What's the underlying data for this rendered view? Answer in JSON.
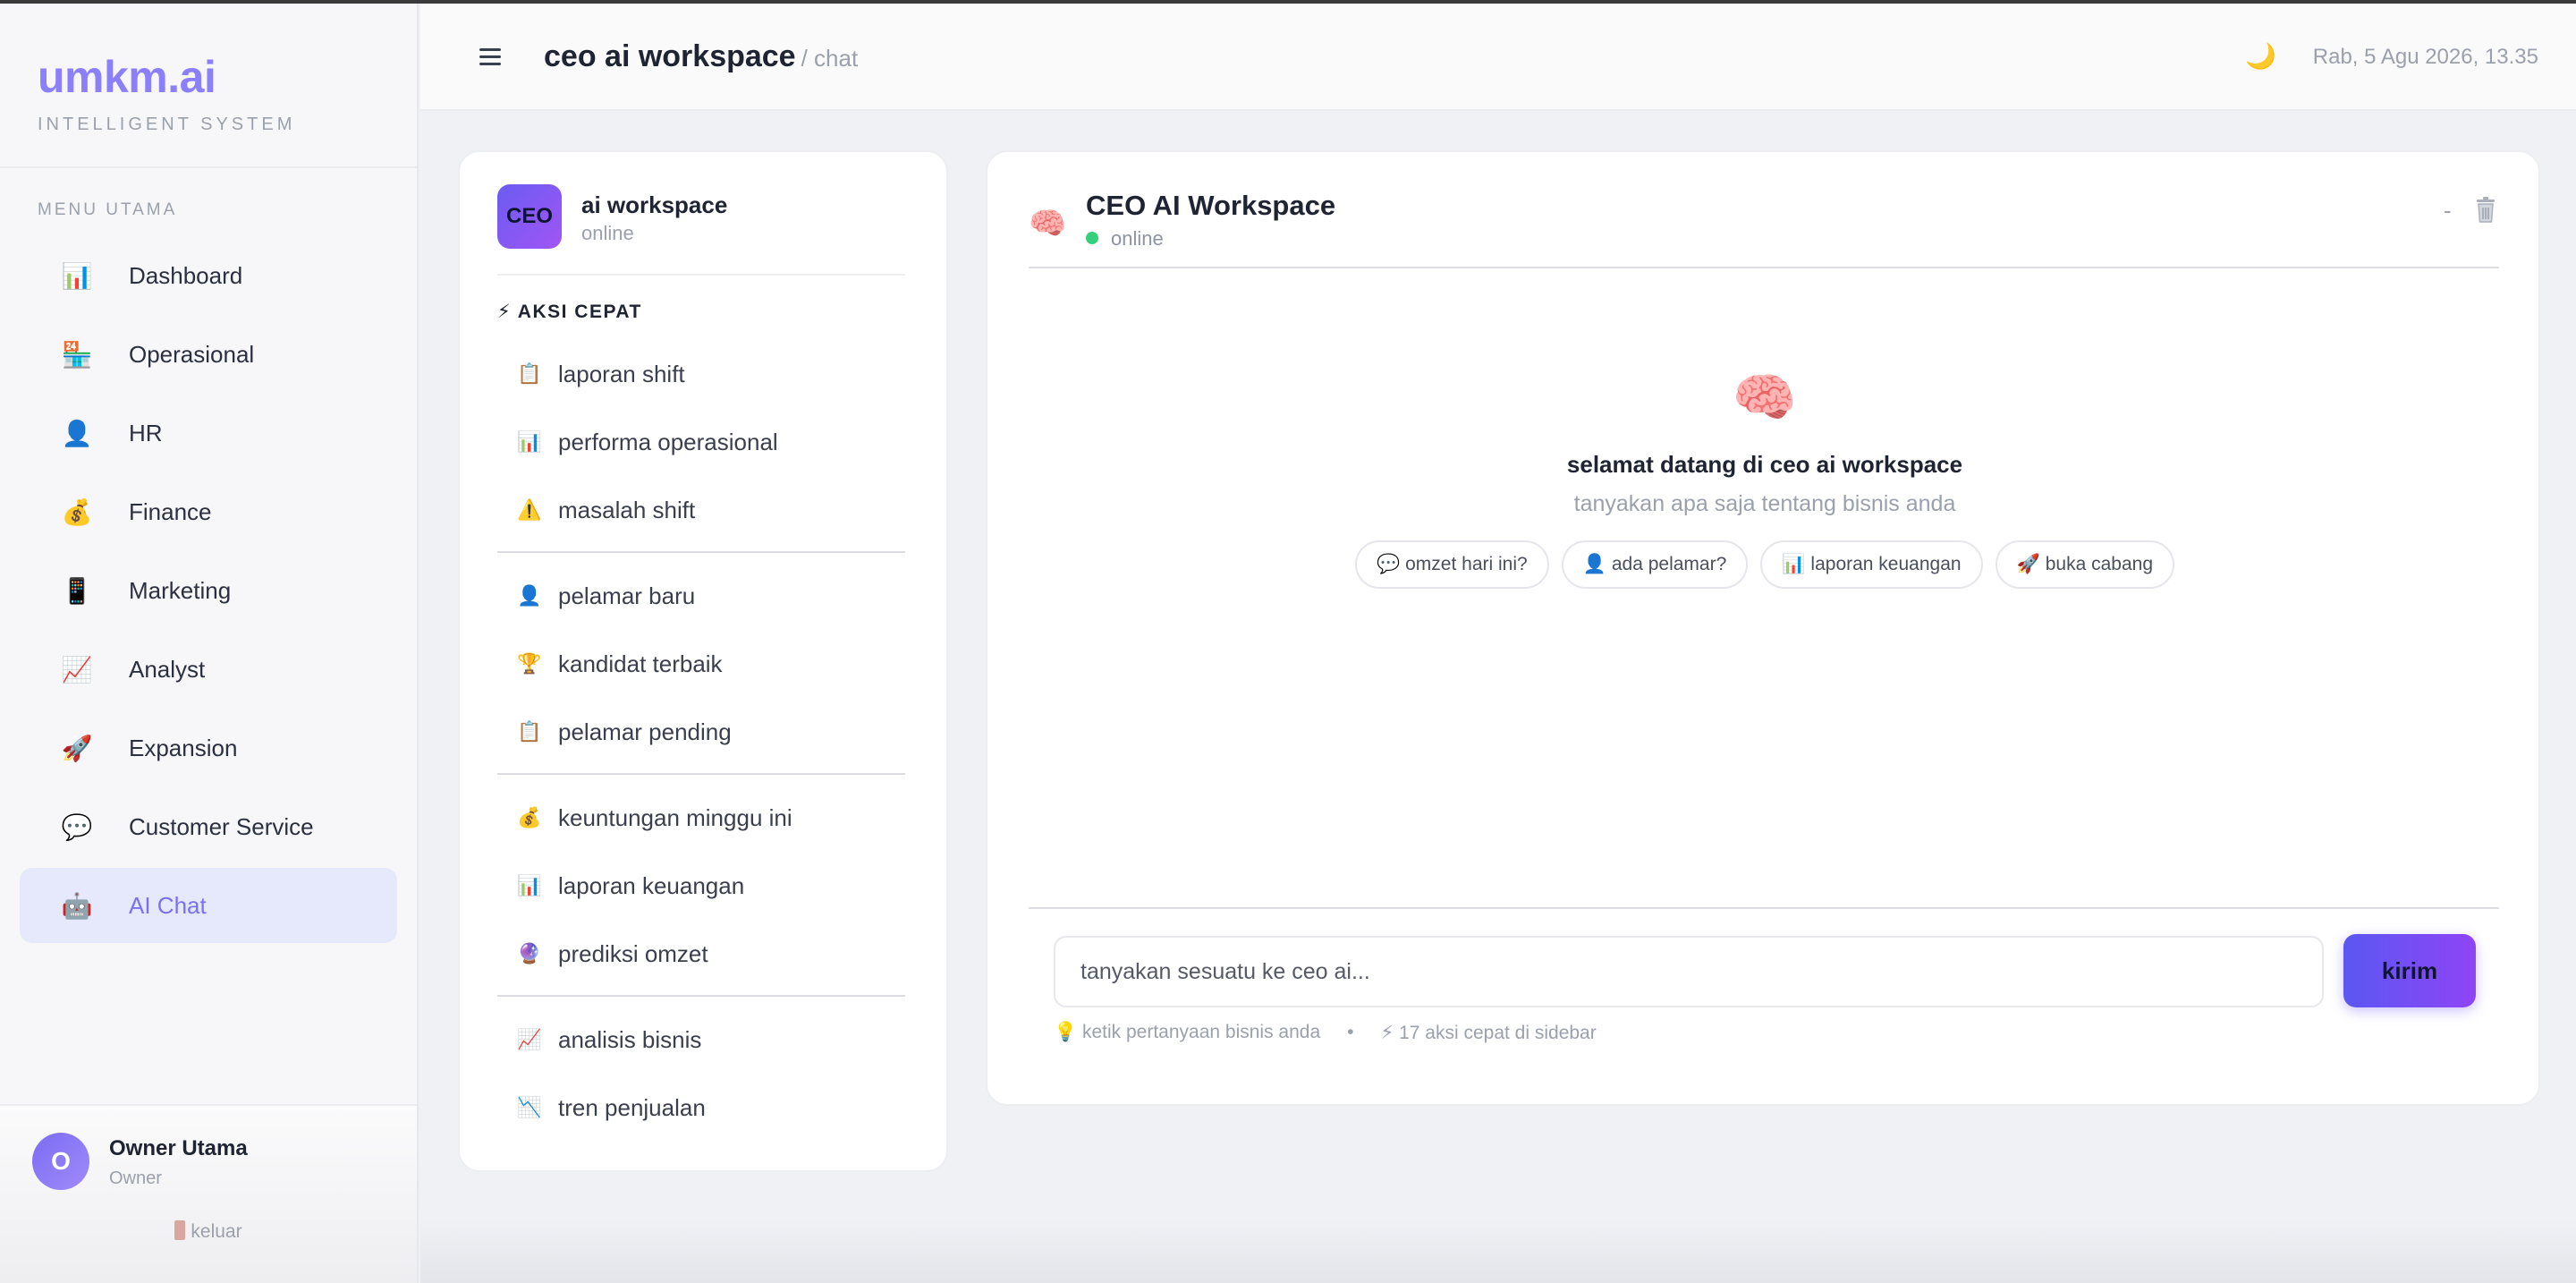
{
  "brand": {
    "name": "umkm.ai",
    "subtitle": "INTELLIGENT SYSTEM"
  },
  "sidebar": {
    "menu_title": "MENU UTAMA",
    "items": [
      {
        "icon": "📊",
        "icon_name": "bar-chart-icon",
        "label": "Dashboard"
      },
      {
        "icon": "🏪",
        "icon_name": "store-icon",
        "label": "Operasional"
      },
      {
        "icon": "👤",
        "icon_name": "user-icon",
        "label": "HR"
      },
      {
        "icon": "💰",
        "icon_name": "money-bag-icon",
        "label": "Finance"
      },
      {
        "icon": "📱",
        "icon_name": "phone-icon",
        "label": "Marketing"
      },
      {
        "icon": "📈",
        "icon_name": "trend-up-icon",
        "label": "Analyst"
      },
      {
        "icon": "🚀",
        "icon_name": "rocket-icon",
        "label": "Expansion"
      },
      {
        "icon": "💬",
        "icon_name": "speech-bubble-icon",
        "label": "Customer Service"
      },
      {
        "icon": "🤖",
        "icon_name": "robot-icon",
        "label": "AI Chat",
        "active": true
      }
    ],
    "user": {
      "initial": "O",
      "name": "Owner Utama",
      "role": "Owner",
      "logout": "keluar"
    }
  },
  "header": {
    "title": "ceo ai workspace",
    "breadcrumb": "/ chat",
    "theme_icon": "🌙",
    "datetime": "Rab, 5 Agu 2026, 13.35"
  },
  "actions_panel": {
    "badge": "CEO",
    "title": "ai workspace",
    "status": "online",
    "quick_title": "⚡ AKSI CEPAT",
    "groups": [
      [
        {
          "icon": "📋",
          "label": "laporan shift"
        },
        {
          "icon": "📊",
          "label": "performa operasional"
        },
        {
          "icon": "⚠️",
          "label": "masalah shift"
        }
      ],
      [
        {
          "icon": "👤",
          "label": "pelamar baru"
        },
        {
          "icon": "🏆",
          "label": "kandidat terbaik"
        },
        {
          "icon": "📋",
          "label": "pelamar pending"
        }
      ],
      [
        {
          "icon": "💰",
          "label": "keuntungan minggu ini"
        },
        {
          "icon": "📊",
          "label": "laporan keuangan"
        },
        {
          "icon": "🔮",
          "label": "prediksi omzet"
        }
      ],
      [
        {
          "icon": "📈",
          "label": "analisis bisnis"
        },
        {
          "icon": "📉",
          "label": "tren penjualan"
        }
      ]
    ]
  },
  "chat": {
    "icon": "🧠",
    "title": "CEO AI Workspace",
    "status": "online",
    "minimize": "-",
    "welcome_title": "selamat datang di ceo ai workspace",
    "welcome_sub": "tanyakan apa saja tentang bisnis anda",
    "chips": [
      {
        "icon": "💬",
        "label": "omzet hari ini?"
      },
      {
        "icon": "👤",
        "label": "ada pelamar?"
      },
      {
        "icon": "📊",
        "label": "laporan keuangan"
      },
      {
        "icon": "🚀",
        "label": "buka cabang"
      }
    ],
    "input_placeholder": "tanyakan sesuatu ke ceo ai...",
    "send_label": "kirim",
    "hint_1": "💡 ketik pertanyaan bisnis anda",
    "hint_sep": "•",
    "hint_2": "⚡ 17 aksi cepat di sidebar"
  }
}
